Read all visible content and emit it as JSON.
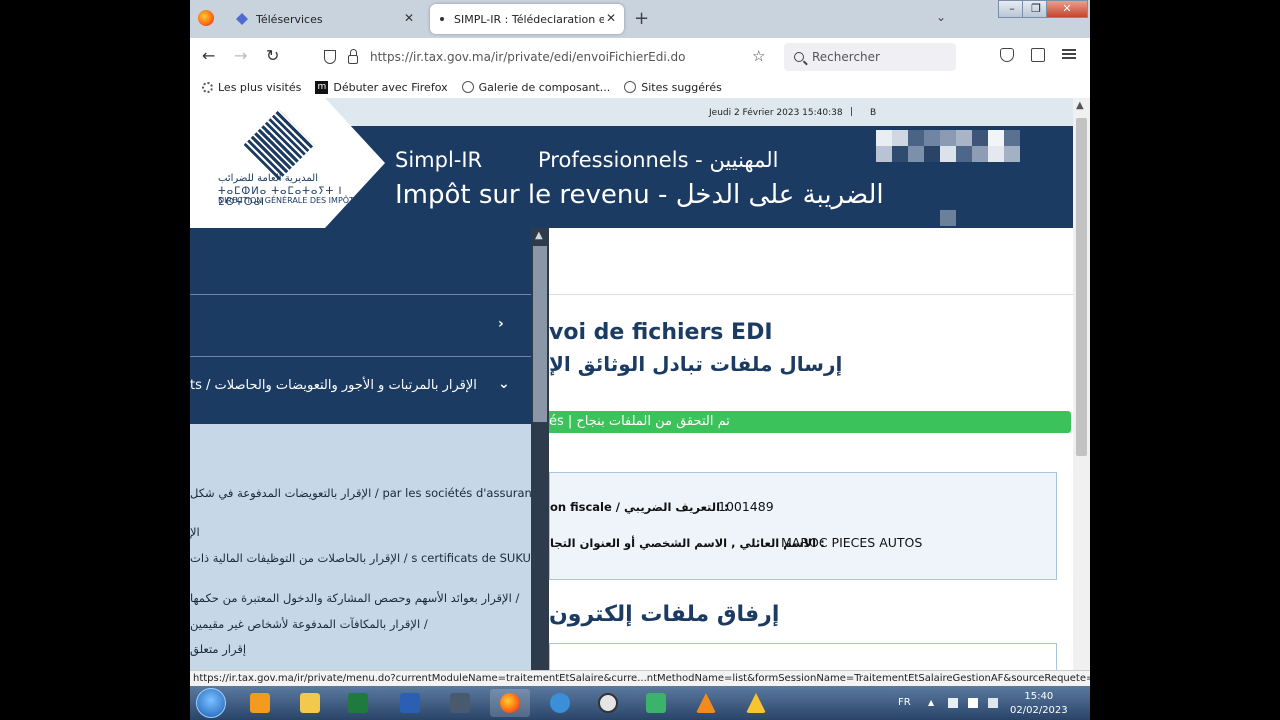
{
  "browser": {
    "tabs": [
      {
        "label": "Téléservices"
      },
      {
        "label": "SIMPL-IR : Télédeclaration et Té..."
      }
    ],
    "url": "https://ir.tax.gov.ma/ir/private/edi/envoiFichierEdi.do",
    "search_placeholder": "Rechercher",
    "bookmarks": [
      "Les plus visités",
      "Débuter avec Firefox",
      "Galerie de composant...",
      "Sites suggérés"
    ],
    "status_url": "https://ir.tax.gov.ma/ir/private/menu.do?currentModuleName=traitementEtSalaire&curre...ntMethodName=list&formSessionName=TraitementEtSalaireGestionAF&sourceRequete=edition"
  },
  "site": {
    "date": "Jeudi 2 Février 2023 15:40:38",
    "separator": "|",
    "user_initial": "B",
    "logo_ar": "المديرية العامة للضرائب",
    "logo_tifinagh": "ⵜⴰⵎⵀⵍⴰ ⵜⴰⵎⴰⵜⴰⵢⵜ ⵏ ⵉⵙⵖⵔⴰⵏ",
    "logo_fr": "DIRECTION GÉNÉRALE DES IMPÔTS",
    "app_name": "Simpl-IR",
    "space": "Professionnels - المهنيين",
    "subtitle": "Impôt sur le revenu - الضريبة على الدخل"
  },
  "menu": {
    "section_title": "ts / الإقرار بالمرتبات و الأجور والتعويضات والحاصلات",
    "items": [
      "الإقرار بالتعويضات المدفوعة في شكل / par les sociétés d'assurances",
      "الإ",
      "الإقرار بالحاصلات من التوظيفات المالية ذات / s certificats de SUKUK",
      "الإقرار بعوائد الأسهم وحصص المشاركة والدخول المعتبرة من حكمها /",
      "الإقرار بالمكافآت المدفوعة لأشخاص غير مقيمين /",
      "إقرار متعلق"
    ]
  },
  "main": {
    "title": "voi de fichiers EDI",
    "title_ar": "إرسال ملفات تبادل الوثائق الإ",
    "success": "és  |  تم التحقق من الملفات بنجاح",
    "id_label": "on fiscale / التعريف الضريبي   :",
    "id_value": "1001489",
    "name_label": "الاسم العائلي , الاسم الشخصي أو العنوان التجا   :",
    "name_value": "MAROC PIECES AUTOS",
    "attach_title": "إرفاق ملفات إلكترون"
  },
  "taskbar": {
    "lang": "FR",
    "time": "15:40",
    "date": "02/02/2023"
  },
  "colors": {
    "header_blue": "#1b3b63",
    "menu_bg": "#c6d8e8",
    "success_green": "#3cc25a"
  }
}
